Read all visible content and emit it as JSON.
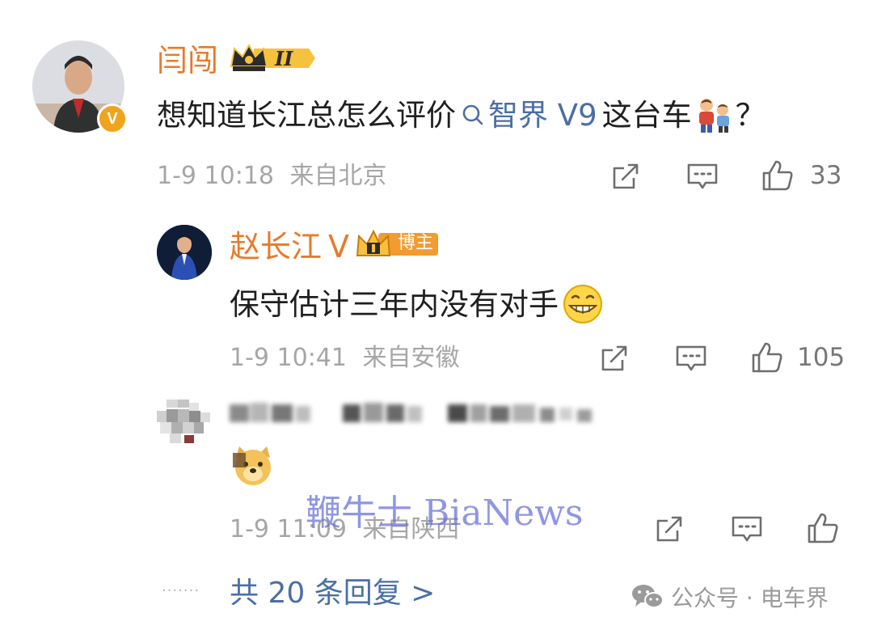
{
  "comment": {
    "username": "闫闯",
    "badge_text": "II",
    "content_before": "想知道长江总怎么评价",
    "topic": "智界 V9",
    "content_after": "这台车",
    "content_end": "？",
    "time": "1-9 10:18",
    "location": "来自北京",
    "likes": "33"
  },
  "reply1": {
    "username": "赵长江",
    "verified_mark": "V",
    "badge_text": "博主",
    "content": "保守估计三年内没有对手",
    "time": "1-9 10:41",
    "location": "来自安徽",
    "likes": "105"
  },
  "reply2": {
    "time": "1-9 11:09",
    "location": "来自陕西"
  },
  "footer": {
    "dots": "·······",
    "more_replies": "共 20 条回复 >",
    "source": "公众号 · 电车界"
  },
  "watermark": "鞭牛士 BiaNews",
  "colors": {
    "username": "#e8792a",
    "link": "#4a6fa5",
    "meta": "#a6a6a6",
    "verified": "#f0a31c"
  }
}
